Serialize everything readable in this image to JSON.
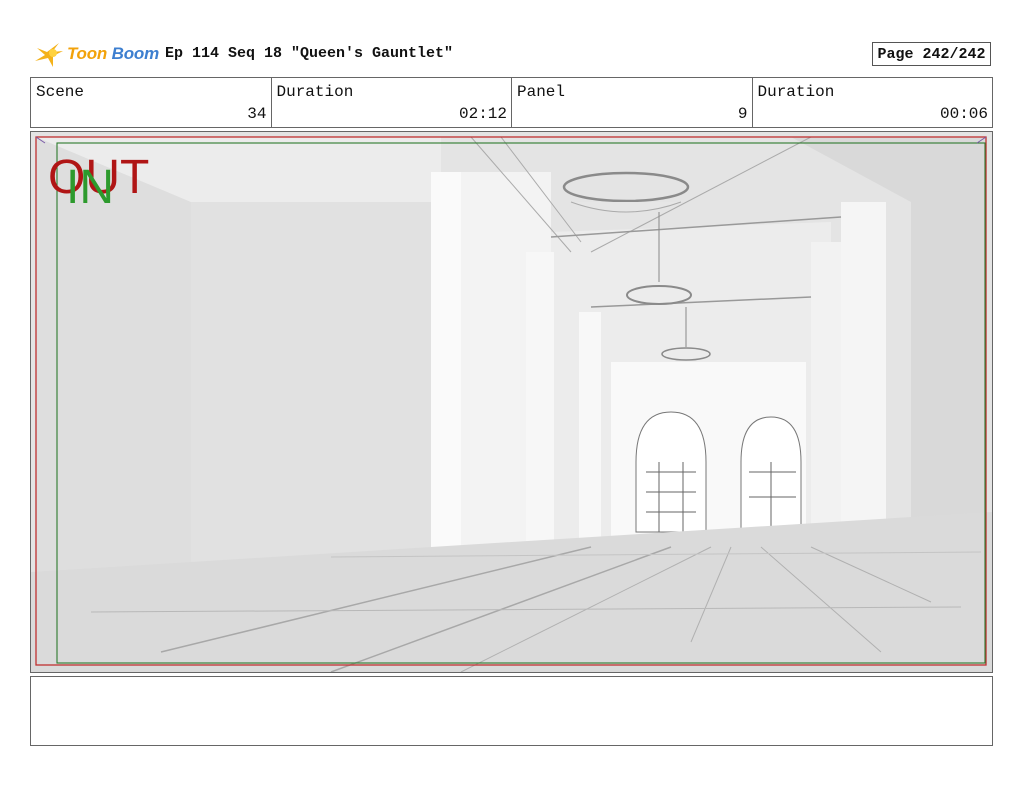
{
  "header": {
    "logo_text_toon": "Toon",
    "logo_text_boom": "Boom",
    "logo_icon": "star-burst-icon",
    "episode_title": "Ep 114 Seq 18 \"Queen's Gauntlet\"",
    "page_label": "Page 242/242"
  },
  "info": {
    "scene_label": "Scene",
    "scene_value": "34",
    "scene_duration_label": "Duration",
    "scene_duration_value": "02:12",
    "panel_label": "Panel",
    "panel_value": "9",
    "panel_duration_label": "Duration",
    "panel_duration_value": "00:06"
  },
  "panel": {
    "out_label": "OUT",
    "in_label": "IN",
    "out_color": "#b01515",
    "in_color": "#2d9a2d"
  },
  "notes": {
    "text": ""
  }
}
